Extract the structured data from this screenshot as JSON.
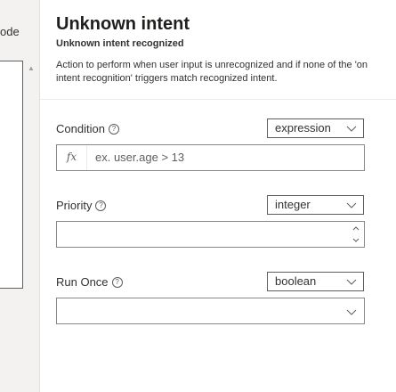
{
  "left_pane": {
    "partial_text": "ode"
  },
  "header": {
    "title": "Unknown intent",
    "subtitle": "Unknown intent recognized",
    "description": "Action to perform when user input is unrecognized and if none of the 'on intent recognition' triggers match recognized intent."
  },
  "fields": {
    "condition": {
      "label": "Condition",
      "type_value": "expression",
      "fx_label": "fx",
      "placeholder": "ex. user.age > 13"
    },
    "priority": {
      "label": "Priority",
      "type_value": "integer",
      "value": ""
    },
    "run_once": {
      "label": "Run Once",
      "type_value": "boolean",
      "value": ""
    }
  },
  "icons": {
    "help": "help-circle-icon",
    "chevron": "chevron-down-icon",
    "spin_up": "chevron-up-icon",
    "spin_down": "chevron-down-icon"
  }
}
